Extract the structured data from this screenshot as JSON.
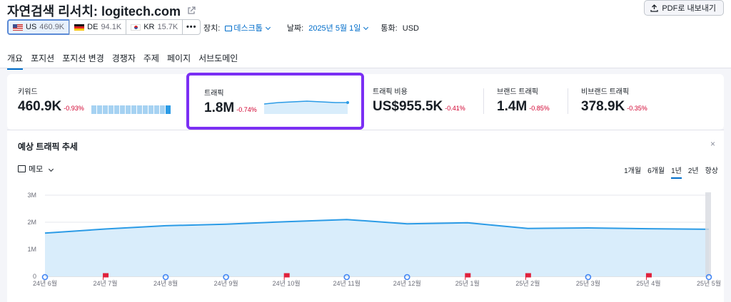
{
  "header": {
    "title": "자연검색 리서치:",
    "domain": "logitech.com",
    "pdf_button": "PDF로 내보내기"
  },
  "databases": [
    {
      "code": "US",
      "value": "460.9K",
      "flag": "flag-us"
    },
    {
      "code": "DE",
      "value": "94.1K",
      "flag": "flag-de"
    },
    {
      "code": "KR",
      "value": "15.7K",
      "flag": "flag-kr"
    }
  ],
  "more_label": "•••",
  "filters": {
    "device_label": "장치:",
    "device_value": "데스크톱",
    "date_label": "날짜:",
    "date_value": "2025년 5월 1일",
    "currency_label": "통화:",
    "currency_value": "USD"
  },
  "tabs": [
    "개요",
    "포지션",
    "포지션 변경",
    "경쟁자",
    "주제",
    "페이지",
    "서브도메인"
  ],
  "metrics": [
    {
      "label": "키워드",
      "value": "460.9K",
      "change": "-0.93%"
    },
    {
      "label": "트래픽",
      "value": "1.8M",
      "change": "-0.74%"
    },
    {
      "label": "트래픽 비용",
      "value": "US$955.5K",
      "change": "-0.41%"
    },
    {
      "label": "브랜드 트래픽",
      "value": "1.4M",
      "change": "-0.85%"
    },
    {
      "label": "비브랜드 트래픽",
      "value": "378.9K",
      "change": "-0.35%"
    }
  ],
  "chart_panel": {
    "title": "예상 트래픽 추세",
    "close": "×",
    "memo": "메모",
    "periods": [
      "1개월",
      "6개월",
      "1년",
      "2년",
      "항상"
    ],
    "active_period": "1년"
  },
  "colors": {
    "accent": "#006dca",
    "highlight": "#7b2ff4",
    "negative": "#d1002f",
    "line": "#2b9be6",
    "fill": "#d9edfb"
  },
  "chart_data": {
    "type": "area",
    "x": [
      "24년 6월",
      "24년 7월",
      "24년 8월",
      "24년 9월",
      "24년 10월",
      "24년 11월",
      "24년 12월",
      "25년 1월",
      "25년 2월",
      "25년 3월",
      "25년 4월",
      "25년 5월"
    ],
    "series": [
      {
        "values": [
          1.6,
          1.75,
          1.87,
          1.93,
          2.02,
          2.1,
          1.94,
          1.98,
          1.77,
          1.79,
          1.76,
          1.74
        ]
      }
    ],
    "ylim": [
      0,
      3
    ],
    "yticks": [
      "0",
      "1M",
      "2M",
      "3M"
    ],
    "markers": [
      "google",
      "note",
      "google",
      "google",
      "note",
      "google",
      "google",
      "note",
      "note",
      "google",
      "note",
      "google"
    ],
    "grid": true
  }
}
